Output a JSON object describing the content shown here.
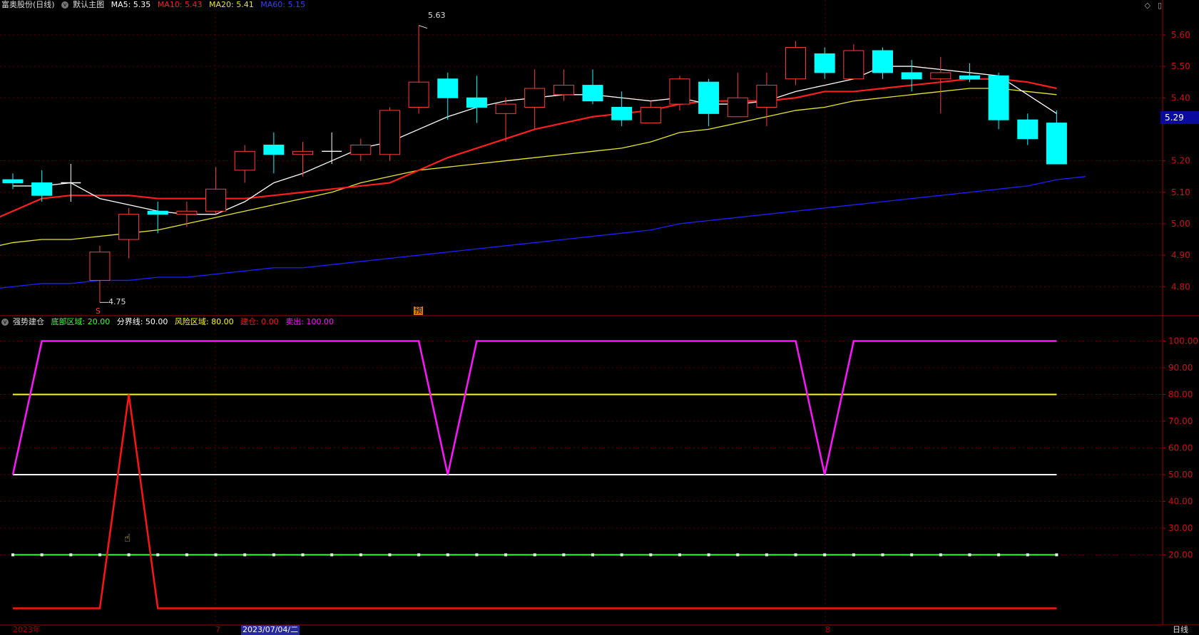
{
  "main_header": {
    "stock_name": "富奥股份(日线)",
    "template": "默认主图",
    "ma5": "MA5: 5.35",
    "ma10": "MA10: 5.43",
    "ma20": "MA20: 5.41",
    "ma60": "MA60: 5.15"
  },
  "sub_header": {
    "indicator": "强势建仓",
    "bottom_zone": "底部区域: 20.00",
    "divider": "分界线: 50.00",
    "risk_zone": "风险区域: 80.00",
    "build": "建仓: 0.00",
    "sell": "卖出: 100.00"
  },
  "window_controls": [
    "◇",
    "▯"
  ],
  "price_axis": {
    "labels": [
      "5.60",
      "5.50",
      "5.40",
      "5.29",
      "5.20",
      "5.10",
      "5.00",
      "4.90",
      "4.80"
    ],
    "current_price": "5.29",
    "range": [
      4.71,
      5.67
    ]
  },
  "indicator_axis": {
    "labels": [
      "100.00",
      "90.00",
      "80.00",
      "70.00",
      "60.00",
      "50.00",
      "40.00",
      "30.00",
      "20.00"
    ],
    "range": [
      -6,
      106
    ]
  },
  "annotations": {
    "high": "5.63",
    "low": "4.75",
    "low_marker": "S",
    "event_marker": "预"
  },
  "time_axis": {
    "year": "2023年",
    "month7": "7",
    "current_date": "2023/07/04/二",
    "month8": "8"
  },
  "period": "日线",
  "colors": {
    "up": "#ff3c3c",
    "down": "#00ffff",
    "ma5": "#ffffff",
    "ma10": "#ff1e1e",
    "ma20": "#e6e632",
    "ma60": "#1e1eff",
    "grid": "#5a0000",
    "axis": "#aa0000",
    "bottom_zone": "#3cff3c",
    "divider": "#ffffff",
    "risk_zone": "#ffff00",
    "build": "#ff1414",
    "sell": "#ff14ff"
  },
  "chart_data": {
    "type": "candlestick",
    "candles": [
      {
        "o": 5.14,
        "c": 5.13,
        "h": 5.16,
        "l": 5.11
      },
      {
        "o": 5.13,
        "c": 5.09,
        "h": 5.17,
        "l": 5.07
      },
      {
        "o": 5.13,
        "c": 5.13,
        "h": 5.19,
        "l": 5.07
      },
      {
        "o": 4.82,
        "c": 4.91,
        "h": 4.93,
        "l": 4.75
      },
      {
        "o": 4.95,
        "c": 5.03,
        "h": 5.05,
        "l": 4.89
      },
      {
        "o": 5.04,
        "c": 5.03,
        "h": 5.07,
        "l": 4.97
      },
      {
        "o": 5.03,
        "c": 5.04,
        "h": 5.07,
        "l": 4.99
      },
      {
        "o": 5.04,
        "c": 5.11,
        "h": 5.18,
        "l": 5.03
      },
      {
        "o": 5.17,
        "c": 5.23,
        "h": 5.25,
        "l": 5.13
      },
      {
        "o": 5.25,
        "c": 5.22,
        "h": 5.29,
        "l": 5.16
      },
      {
        "o": 5.22,
        "c": 5.23,
        "h": 5.26,
        "l": 5.15
      },
      {
        "o": 5.23,
        "c": 5.23,
        "h": 5.29,
        "l": 5.19
      },
      {
        "o": 5.22,
        "c": 5.25,
        "h": 5.27,
        "l": 5.2
      },
      {
        "o": 5.22,
        "c": 5.36,
        "h": 5.37,
        "l": 5.2
      },
      {
        "o": 5.37,
        "c": 5.45,
        "h": 5.63,
        "l": 5.35
      },
      {
        "o": 5.46,
        "c": 5.4,
        "h": 5.48,
        "l": 5.33
      },
      {
        "o": 5.4,
        "c": 5.37,
        "h": 5.47,
        "l": 5.32
      },
      {
        "o": 5.35,
        "c": 5.38,
        "h": 5.4,
        "l": 5.26
      },
      {
        "o": 5.37,
        "c": 5.43,
        "h": 5.49,
        "l": 5.3
      },
      {
        "o": 5.41,
        "c": 5.44,
        "h": 5.49,
        "l": 5.39
      },
      {
        "o": 5.44,
        "c": 5.39,
        "h": 5.49,
        "l": 5.38
      },
      {
        "o": 5.37,
        "c": 5.33,
        "h": 5.42,
        "l": 5.31
      },
      {
        "o": 5.32,
        "c": 5.37,
        "h": 5.39,
        "l": 5.32
      },
      {
        "o": 5.38,
        "c": 5.46,
        "h": 5.47,
        "l": 5.36
      },
      {
        "o": 5.45,
        "c": 5.35,
        "h": 5.46,
        "l": 5.31
      },
      {
        "o": 5.34,
        "c": 5.4,
        "h": 5.48,
        "l": 5.34
      },
      {
        "o": 5.37,
        "c": 5.44,
        "h": 5.48,
        "l": 5.31
      },
      {
        "o": 5.46,
        "c": 5.56,
        "h": 5.58,
        "l": 5.44
      },
      {
        "o": 5.54,
        "c": 5.48,
        "h": 5.56,
        "l": 5.46
      },
      {
        "o": 5.46,
        "c": 5.55,
        "h": 5.57,
        "l": 5.46
      },
      {
        "o": 5.55,
        "c": 5.48,
        "h": 5.56,
        "l": 5.46
      },
      {
        "o": 5.48,
        "c": 5.46,
        "h": 5.52,
        "l": 5.42
      },
      {
        "o": 5.46,
        "c": 5.48,
        "h": 5.53,
        "l": 5.35
      },
      {
        "o": 5.47,
        "c": 5.46,
        "h": 5.51,
        "l": 5.45
      },
      {
        "o": 5.47,
        "c": 5.33,
        "h": 5.48,
        "l": 5.3
      },
      {
        "o": 5.33,
        "c": 5.27,
        "h": 5.35,
        "l": 5.25
      },
      {
        "o": 5.32,
        "c": 5.19,
        "h": 5.36,
        "l": 5.19
      }
    ],
    "ma5": [
      5.12,
      5.12,
      5.13,
      5.08,
      5.06,
      5.04,
      5.03,
      5.03,
      5.07,
      5.13,
      5.16,
      5.2,
      5.24,
      5.26,
      5.3,
      5.34,
      5.37,
      5.39,
      5.4,
      5.41,
      5.41,
      5.4,
      5.39,
      5.4,
      5.38,
      5.38,
      5.39,
      5.42,
      5.44,
      5.46,
      5.5,
      5.5,
      5.49,
      5.48,
      5.47,
      5.41,
      5.35
    ],
    "ma10": [
      5.0,
      5.04,
      5.08,
      5.09,
      5.09,
      5.09,
      5.08,
      5.08,
      5.08,
      5.08,
      5.09,
      5.1,
      5.11,
      5.12,
      5.13,
      5.17,
      5.21,
      5.24,
      5.27,
      5.3,
      5.32,
      5.34,
      5.35,
      5.36,
      5.38,
      5.39,
      5.39,
      5.39,
      5.4,
      5.42,
      5.42,
      5.43,
      5.44,
      5.45,
      5.46,
      5.46,
      5.45,
      5.43
    ],
    "ma20": [
      4.92,
      4.94,
      4.95,
      4.95,
      4.96,
      4.97,
      4.98,
      5.0,
      5.02,
      5.04,
      5.06,
      5.08,
      5.1,
      5.13,
      5.15,
      5.17,
      5.18,
      5.19,
      5.2,
      5.21,
      5.22,
      5.23,
      5.24,
      5.26,
      5.29,
      5.3,
      5.32,
      5.34,
      5.36,
      5.37,
      5.39,
      5.4,
      5.41,
      5.42,
      5.43,
      5.43,
      5.42,
      5.41
    ],
    "ma60": [
      4.79,
      4.8,
      4.81,
      4.81,
      4.82,
      4.82,
      4.83,
      4.83,
      4.84,
      4.85,
      4.86,
      4.86,
      4.87,
      4.88,
      4.89,
      4.9,
      4.91,
      4.92,
      4.93,
      4.94,
      4.95,
      4.96,
      4.97,
      4.98,
      5.0,
      5.01,
      5.02,
      5.03,
      5.04,
      5.05,
      5.06,
      5.07,
      5.08,
      5.09,
      5.1,
      5.11,
      5.12,
      5.14,
      5.15
    ],
    "indicator": {
      "bottom_zone": 20,
      "divider": 50,
      "risk_zone": 80,
      "build": [
        0,
        0,
        0,
        0,
        80,
        0,
        0,
        0,
        0,
        0,
        0,
        0,
        0,
        0,
        0,
        0,
        0,
        0,
        0,
        0,
        0,
        0,
        0,
        0,
        0,
        0,
        0,
        0,
        0,
        0,
        0,
        0,
        0,
        0,
        0,
        0,
        0,
        0
      ],
      "sell": [
        50,
        100,
        100,
        100,
        100,
        100,
        100,
        100,
        100,
        100,
        100,
        100,
        100,
        100,
        100,
        50,
        100,
        100,
        100,
        100,
        100,
        100,
        100,
        100,
        100,
        100,
        100,
        100,
        50,
        100,
        100,
        100,
        100,
        100,
        100,
        100,
        100,
        100
      ]
    }
  }
}
